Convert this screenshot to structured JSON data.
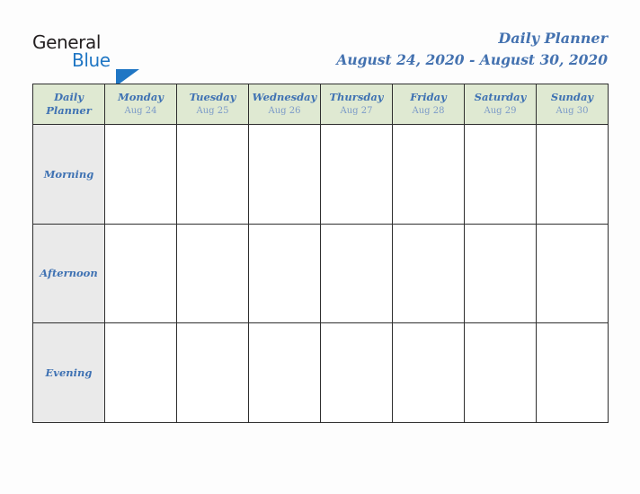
{
  "brand": {
    "name_part1": "General",
    "name_part2": "Blue",
    "triangle_icon": "triangle-icon",
    "color_dark": "#231f20",
    "color_blue": "#1f76c4"
  },
  "header": {
    "title": "Daily Planner",
    "date_range": "August 24, 2020 - August 30, 2020",
    "title_color": "#4472b0"
  },
  "table": {
    "corner_label_line1": "Daily",
    "corner_label_line2": "Planner",
    "header_bg": "#dfe9d2",
    "row_label_bg": "#eaeaea",
    "border_color": "#2e2e2e",
    "day_name_color": "#3f72b3",
    "day_date_color": "#7b9ac8",
    "columns": [
      {
        "day": "Monday",
        "date": "Aug 24"
      },
      {
        "day": "Tuesday",
        "date": "Aug 25"
      },
      {
        "day": "Wednesday",
        "date": "Aug 26"
      },
      {
        "day": "Thursday",
        "date": "Aug 27"
      },
      {
        "day": "Friday",
        "date": "Aug 28"
      },
      {
        "day": "Saturday",
        "date": "Aug 29"
      },
      {
        "day": "Sunday",
        "date": "Aug 30"
      }
    ],
    "rows": [
      {
        "label": "Morning",
        "cells": [
          "",
          "",
          "",
          "",
          "",
          "",
          ""
        ]
      },
      {
        "label": "Afternoon",
        "cells": [
          "",
          "",
          "",
          "",
          "",
          "",
          ""
        ]
      },
      {
        "label": "Evening",
        "cells": [
          "",
          "",
          "",
          "",
          "",
          "",
          ""
        ]
      }
    ]
  }
}
